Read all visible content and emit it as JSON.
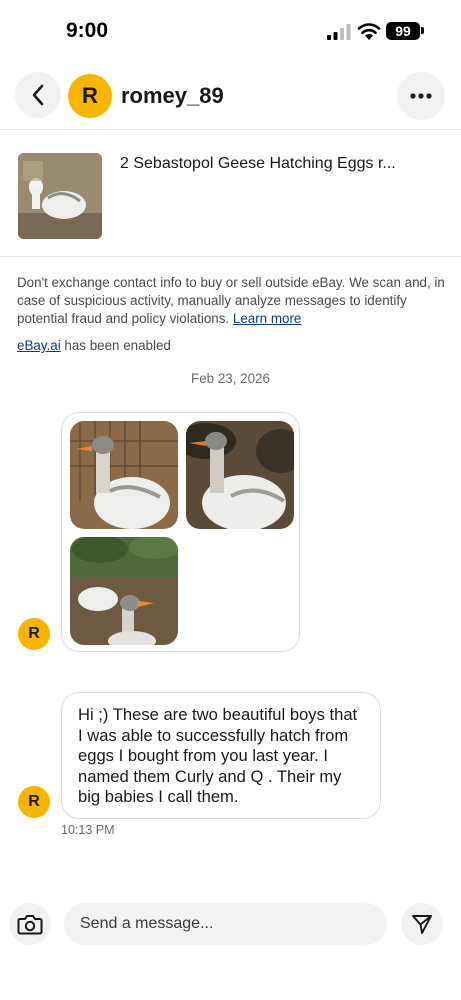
{
  "status_bar": {
    "time": "9:00",
    "battery": "99"
  },
  "header": {
    "avatar_initial": "R",
    "username": "romey_89"
  },
  "listing": {
    "title": "2 Sebastopol Geese Hatching  Eggs r..."
  },
  "notice": {
    "text": "Don't exchange contact info to buy or sell outside eBay. We scan and, in case of suspicious activity, manually analyze messages to identify potential fraud and policy violations. ",
    "link": "Learn more"
  },
  "ai_notice": {
    "link": "eBay.ai",
    "text": " has been enabled"
  },
  "date": "Feb 23, 2026",
  "messages": [
    {
      "avatar_initial": "R",
      "type": "images"
    },
    {
      "avatar_initial": "R",
      "text": "Hi ;) These are two beautiful boys that I was able to successfully hatch from eggs I bought from you last year. I named them Curly and Q . Their my big babies I call them.",
      "time": "10:13 PM"
    }
  ],
  "composer": {
    "placeholder": "Send a message..."
  },
  "colors": {
    "avatar": "#f7b500",
    "link": "#0b3a8c",
    "button_bg": "#f2f2f2"
  }
}
